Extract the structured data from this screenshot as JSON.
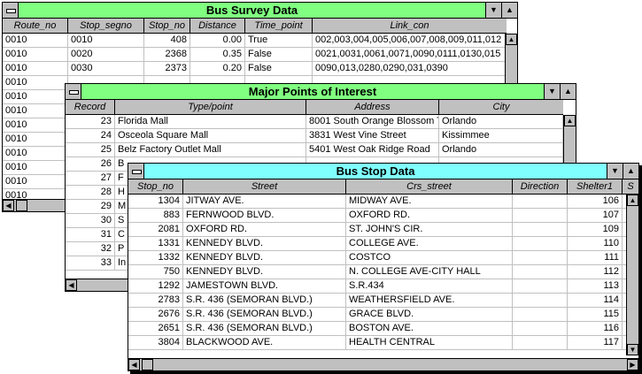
{
  "survey": {
    "title": "Bus Survey Data",
    "columns": [
      "Route_no",
      "Stop_segno",
      "Stop_no",
      "Distance",
      "Time_point",
      "Link_con"
    ],
    "rows": [
      [
        "0010",
        "0010",
        "408",
        "0.00",
        "True",
        "002,003,004,005,006,007,008,009,011,012"
      ],
      [
        "0010",
        "0020",
        "2368",
        "0.35",
        "False",
        "0021,0031,0061,0071,0090,0111,0130,015"
      ],
      [
        "0010",
        "0030",
        "2373",
        "0.20",
        "False",
        "0090,013,0280,0290,031,0390"
      ],
      [
        "0010",
        "",
        "",
        "",
        "",
        ""
      ],
      [
        "0010",
        "",
        "",
        "",
        "",
        ""
      ],
      [
        "0010",
        "",
        "",
        "",
        "",
        ""
      ],
      [
        "0010",
        "",
        "",
        "",
        "",
        ""
      ],
      [
        "0010",
        "",
        "",
        "",
        "",
        ""
      ],
      [
        "0010",
        "",
        "",
        "",
        "",
        ""
      ],
      [
        "0010",
        "",
        "",
        "",
        "",
        ""
      ],
      [
        "0010",
        "",
        "",
        "",
        "",
        ""
      ],
      [
        "0010",
        "",
        "",
        "",
        "",
        ""
      ]
    ]
  },
  "poi": {
    "title": "Major Points of Interest",
    "columns": [
      "Record",
      "Type/point",
      "Address",
      "City"
    ],
    "rows": [
      [
        "23",
        "Florida Mall",
        "8001 South Orange Blossom T",
        "Orlando"
      ],
      [
        "24",
        "Osceola Square Mall",
        "3831 West Vine Street",
        "Kissimmee"
      ],
      [
        "25",
        "Belz Factory Outlet Mall",
        "5401 West Oak Ridge Road",
        "Orlando"
      ],
      [
        "26",
        "B",
        "",
        ""
      ],
      [
        "27",
        "F",
        "",
        ""
      ],
      [
        "28",
        "H",
        "",
        ""
      ],
      [
        "29",
        "M",
        "",
        ""
      ],
      [
        "30",
        "S",
        "",
        ""
      ],
      [
        "31",
        "C",
        "",
        ""
      ],
      [
        "32",
        "P",
        "",
        ""
      ],
      [
        "33",
        "In",
        "",
        ""
      ]
    ]
  },
  "stops": {
    "title": "Bus Stop Data",
    "columns": [
      "Stop_no",
      "Street",
      "Crs_street",
      "Direction",
      "Shelter1",
      "S"
    ],
    "rows": [
      [
        "1304",
        "JITWAY AVE.",
        "MIDWAY AVE.",
        "",
        "106"
      ],
      [
        "883",
        "FERNWOOD BLVD.",
        "OXFORD RD.",
        "",
        "107"
      ],
      [
        "2081",
        "OXFORD RD.",
        "ST. JOHN'S CIR.",
        "",
        "109"
      ],
      [
        "1331",
        "KENNEDY BLVD.",
        "COLLEGE AVE.",
        "",
        "110"
      ],
      [
        "1332",
        "KENNEDY BLVD.",
        "COSTCO",
        "",
        "111"
      ],
      [
        "750",
        "KENNEDY BLVD.",
        "N. COLLEGE AVE-CITY HALL",
        "",
        "112"
      ],
      [
        "1292",
        "JAMESTOWN BLVD.",
        "S.R.434",
        "",
        "113"
      ],
      [
        "2783",
        "S.R. 436 (SEMORAN BLVD.)",
        "WEATHERSFIELD AVE.",
        "",
        "114"
      ],
      [
        "2676",
        "S.R. 436 (SEMORAN BLVD.)",
        "GRACE BLVD.",
        "",
        "115"
      ],
      [
        "2651",
        "S.R. 436 (SEMORAN BLVD.)",
        "BOSTON AVE.",
        "",
        "116"
      ],
      [
        "3804",
        "BLACKWOOD AVE.",
        "HEALTH CENTRAL",
        "",
        "117"
      ]
    ]
  },
  "colors": {
    "survey_title_bg": "#80ff80",
    "poi_title_bg": "#80ff80",
    "stops_title_bg": "#80ffff",
    "chrome": "#c0c0c0"
  },
  "icons": [
    "system-menu-icon",
    "dropdown-arrow-icon",
    "scroll-up-icon",
    "scroll-down-icon",
    "scroll-left-icon",
    "scroll-right-icon"
  ]
}
